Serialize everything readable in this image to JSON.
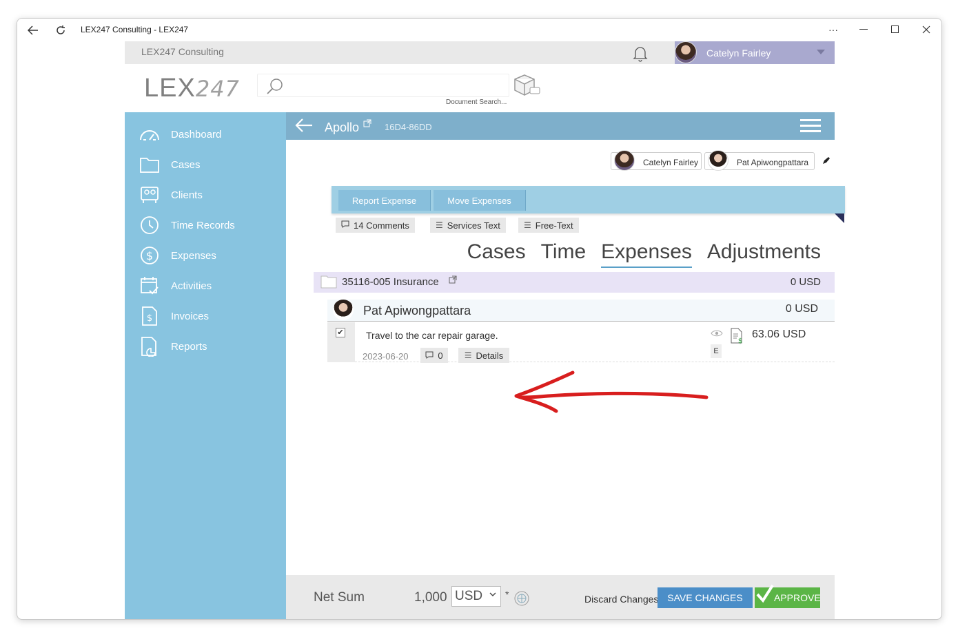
{
  "window": {
    "title": "LEX247 Consulting - LEX247",
    "more_label": "···"
  },
  "topbar": {
    "company": "LEX247 Consulting",
    "user_name": "Catelyn Fairley"
  },
  "header": {
    "logo_main": "LEX",
    "logo_thin": "247",
    "search_label": "Document Search..."
  },
  "sidebar": {
    "items": [
      {
        "label": "Dashboard",
        "icon": "dashboard-icon"
      },
      {
        "label": "Cases",
        "icon": "folder-icon"
      },
      {
        "label": "Clients",
        "icon": "clients-icon"
      },
      {
        "label": "Time Records",
        "icon": "clock-icon"
      },
      {
        "label": "Expenses",
        "icon": "dollar-icon"
      },
      {
        "label": "Activities",
        "icon": "calendar-icon"
      },
      {
        "label": "Invoices",
        "icon": "invoice-icon"
      },
      {
        "label": "Reports",
        "icon": "report-icon"
      }
    ]
  },
  "casebar": {
    "name": "Apollo",
    "code": "16D4-86DD"
  },
  "assignees": [
    {
      "name": "Catelyn Fairley"
    },
    {
      "name": "Pat Apiwongpattara"
    }
  ],
  "actions": {
    "report_expense": "Report Expense",
    "move_expenses": "Move Expenses"
  },
  "tags": {
    "comments": "14 Comments",
    "services_text": "Services Text",
    "free_text": "Free-Text"
  },
  "tabs": [
    {
      "label": "Cases",
      "active": false
    },
    {
      "label": "Time",
      "active": false
    },
    {
      "label": "Expenses",
      "active": true
    },
    {
      "label": "Adjustments",
      "active": false
    }
  ],
  "case_row": {
    "label": "35116-005 Insurance",
    "amount": "0 USD"
  },
  "person_row": {
    "name": "Pat Apiwongpattara",
    "amount": "0 USD"
  },
  "expense": {
    "checked": true,
    "check_mark": "✔",
    "description": "Travel to the car repair garage.",
    "date": "2023-06-20",
    "comment_count": "0",
    "details_label": "Details",
    "amount": "63.06 USD",
    "badge": "E"
  },
  "footer": {
    "net_sum_label": "Net Sum",
    "net_sum_value": "1,000",
    "currency": "USD",
    "star": "*",
    "discard": "Discard Changes",
    "save": "SAVE CHANGES",
    "approve": "APPROVE"
  },
  "colors": {
    "sidebar": "#88c4e0",
    "casebar": "#7eafcb",
    "save": "#4b8ec8",
    "approve": "#5bb546",
    "arrow": "#d81e1e"
  }
}
